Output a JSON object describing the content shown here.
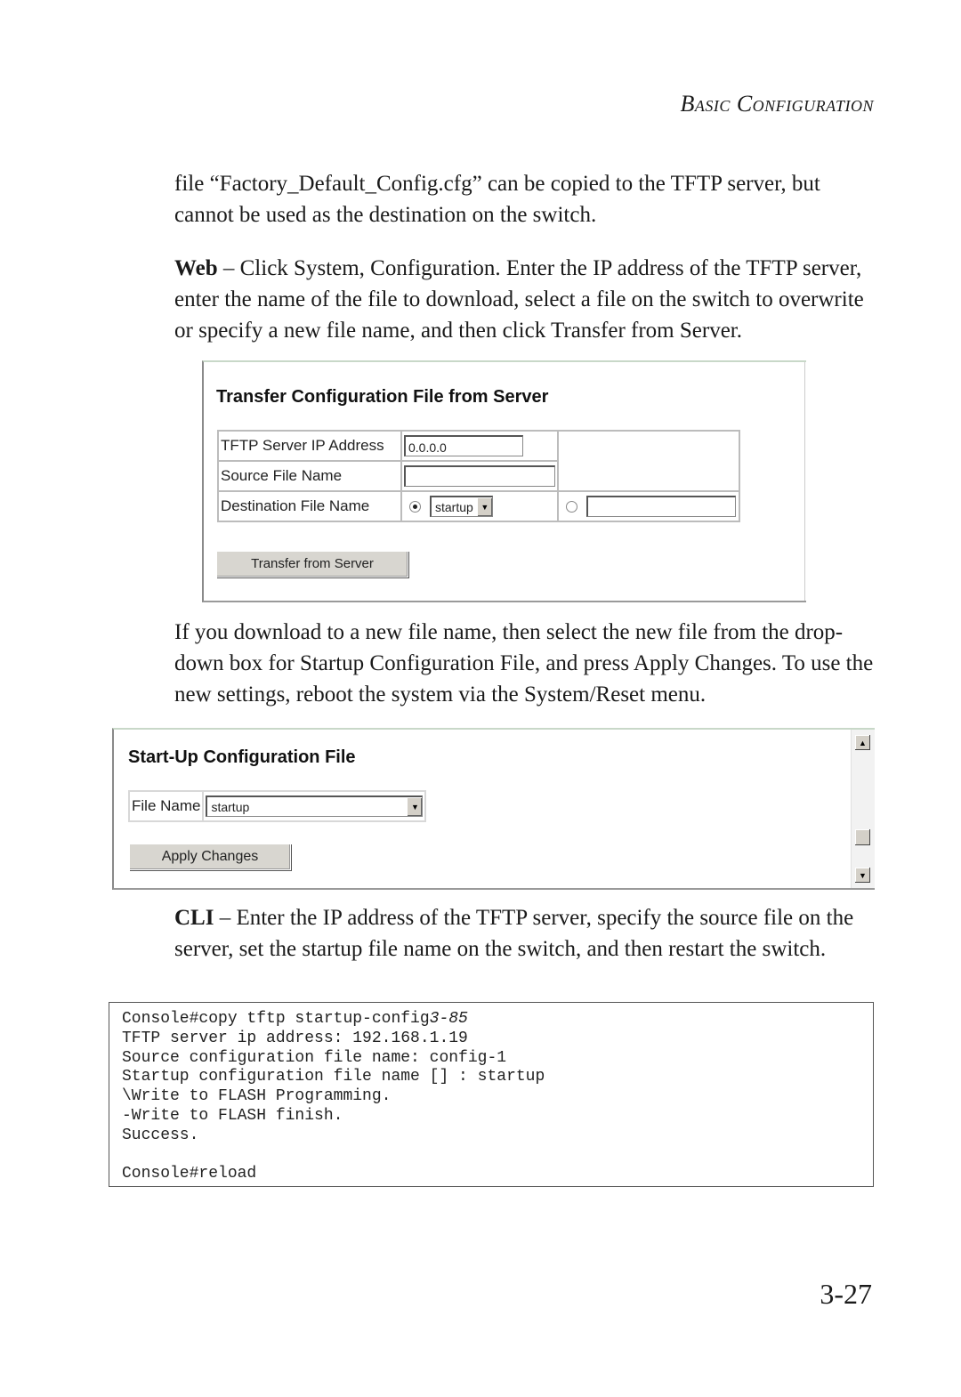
{
  "header": {
    "running_head": "Basic Configuration"
  },
  "paragraphs": {
    "p1": "file “Factory_Default_Config.cfg” can be copied to the TFTP server, but cannot be used as the destination on the switch.",
    "p2_lead": "Web",
    "p2": " – Click System, Configuration. Enter the IP address of the TFTP server, enter the name of the file to download, select a file on the switch to overwrite or specify a new file name, and then click Transfer from Server.",
    "p3": "If you download to a new file name, then select the new file from the drop-down box for Startup Configuration File, and press Apply Changes. To use the new settings, reboot the system via the System/Reset menu.",
    "p4_lead": "CLI",
    "p4": " – Enter the IP address of the TFTP server, specify the source file on the server, set the startup file name on the switch, and then restart the switch."
  },
  "transfer_panel": {
    "title": "Transfer Configuration File from Server",
    "rows": [
      {
        "label": "TFTP Server IP Address",
        "value": "0.0.0.0"
      },
      {
        "label": "Source File Name",
        "value": ""
      },
      {
        "label": "Destination File Name",
        "select_value": "startup",
        "new_name_value": ""
      }
    ],
    "destination_selected": "existing",
    "button_label": "Transfer from Server"
  },
  "startup_panel": {
    "title": "Start-Up Configuration File",
    "file_name_label": "File Name",
    "file_name_value": "startup",
    "button_label": "Apply Changes"
  },
  "cli": {
    "lines": [
      "Console#copy tftp startup-config",
      "TFTP server ip address: 192.168.1.19",
      "Source configuration file name: config-1",
      "Startup configuration file name [] : startup",
      "\\Write to FLASH Programming.",
      "-Write to FLASH finish.",
      "Success.",
      "",
      "Console#reload"
    ],
    "first_line_ref": "3-85"
  },
  "footer": {
    "page_number": "3-27"
  }
}
